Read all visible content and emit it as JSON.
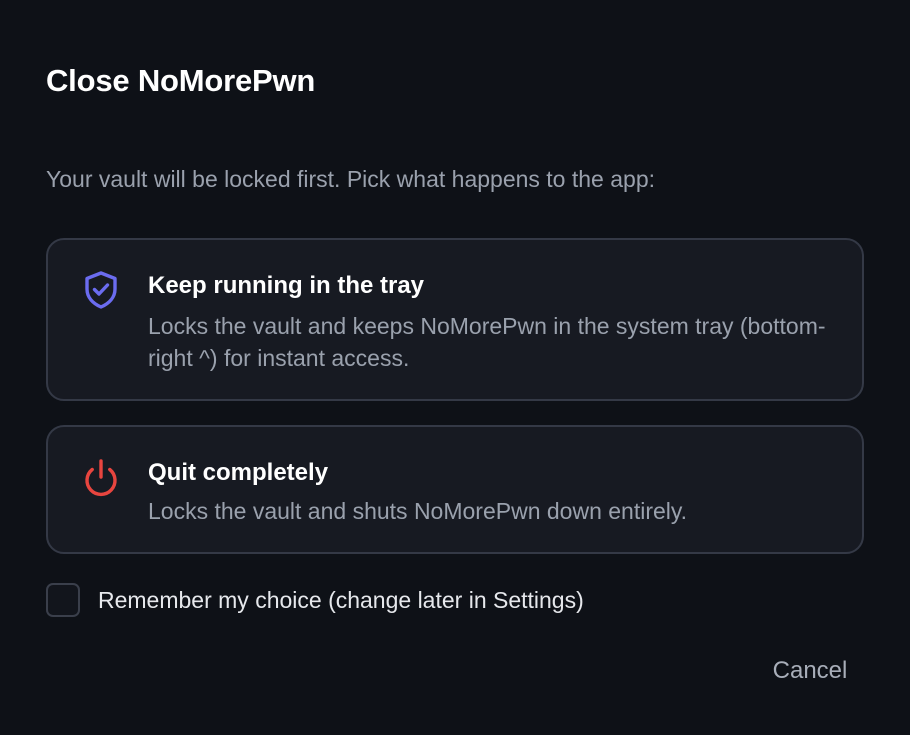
{
  "dialog": {
    "title": "Close NoMorePwn",
    "subtitle": "Your vault will be locked first. Pick what happens to the app:"
  },
  "options": [
    {
      "title": "Keep running in the tray",
      "description": "Locks the vault and keeps NoMorePwn in the system tray (bottom-right ^) for instant access.",
      "icon": "shield-check-icon",
      "icon_color": "#6b6cf0"
    },
    {
      "title": "Quit completely",
      "description": "Locks the vault and shuts NoMorePwn down entirely.",
      "icon": "power-icon",
      "icon_color": "#e8453f"
    }
  ],
  "remember": {
    "label": "Remember my choice (change later in Settings)",
    "checked": false
  },
  "actions": {
    "cancel_label": "Cancel"
  },
  "colors": {
    "background": "#0e1117",
    "card_background": "#171a22",
    "card_border": "#343946",
    "muted_text": "#9aa1ad"
  }
}
